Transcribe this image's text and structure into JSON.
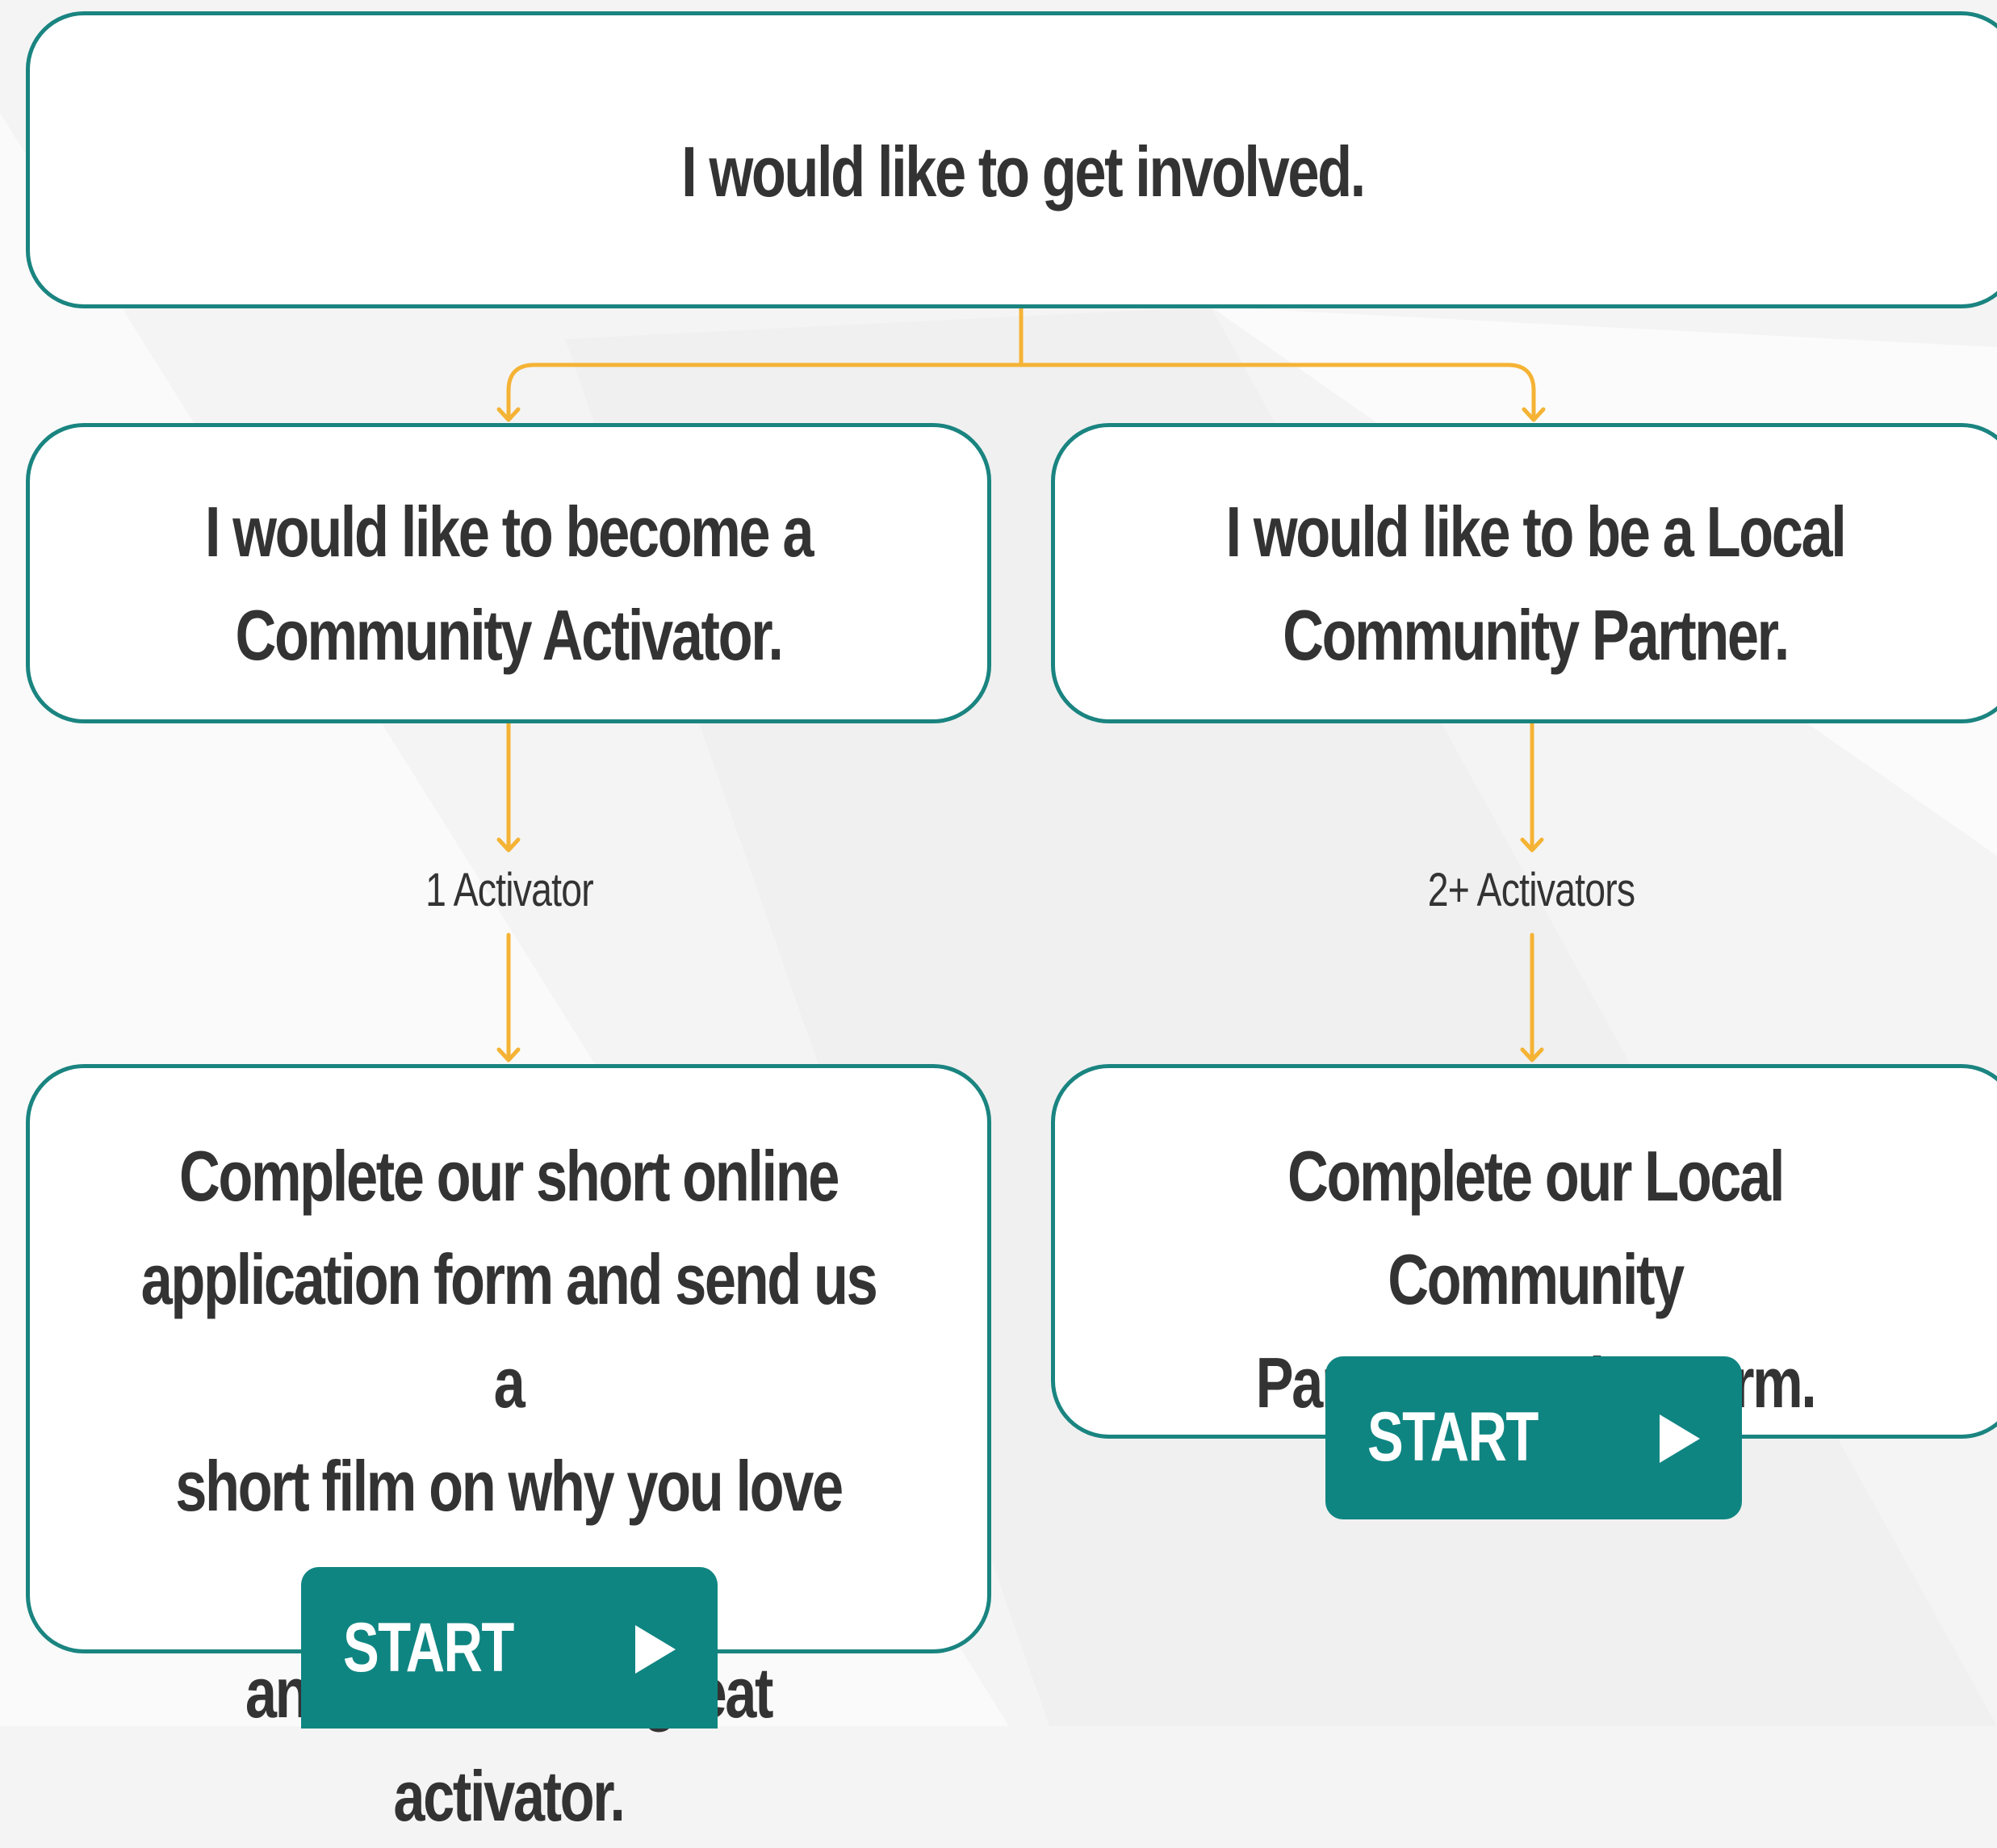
{
  "flow": {
    "start_title": "I would like to get involved.",
    "branches": [
      {
        "title_line1": "I would like to become a",
        "title_line2": "Community Activator.",
        "condition": "1 Activator",
        "step_lines": [
          "Complete our short online",
          "application form and send us a",
          "short film on why you love sport",
          "and would be a great activator."
        ],
        "button_label": "START"
      },
      {
        "title_line1": "I would like to be a Local",
        "title_line2": "Community Partner.",
        "condition": "2+ Activators",
        "step_lines": [
          "Complete our Local Community",
          "Partner Enquiry Form."
        ],
        "button_label": "START"
      }
    ]
  },
  "colors": {
    "box_border": "#1a8480",
    "connector": "#f5b335",
    "button": "#0f8582",
    "text": "#333333",
    "background": "#f4f4f4"
  },
  "icons": {
    "button_icon": "play-icon"
  }
}
